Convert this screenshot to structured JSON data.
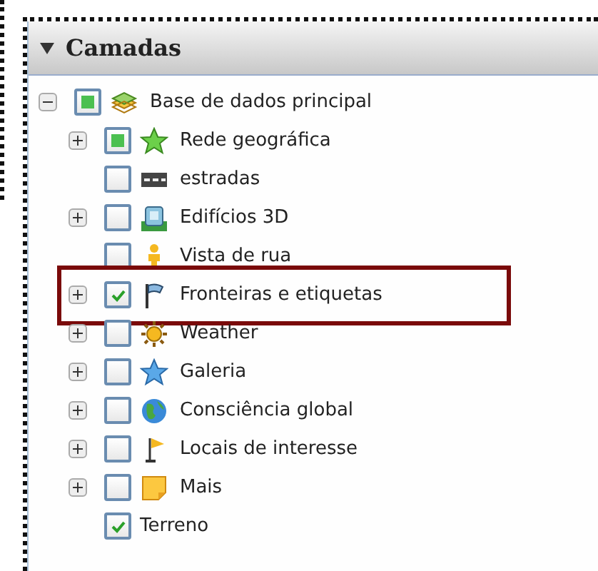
{
  "panel": {
    "title": "Camadas",
    "expanded": true
  },
  "tree": [
    {
      "label": "Base de dados principal",
      "checked": true,
      "partial": true,
      "expanded": true,
      "highlighted": false,
      "children": [
        {
          "label": "Rede geográfica",
          "checked": true,
          "partial": true,
          "expanded": false,
          "highlighted": false
        },
        {
          "label": "estradas",
          "checked": false,
          "partial": false,
          "highlighted": false
        },
        {
          "label": "Edifícios 3D",
          "checked": false,
          "partial": false,
          "expanded": false,
          "highlighted": false
        },
        {
          "label": "Vista de rua",
          "checked": false,
          "partial": false,
          "highlighted": false
        },
        {
          "label": "Fronteiras e etiquetas",
          "checked": true,
          "partial": false,
          "expanded": false,
          "highlighted": true
        },
        {
          "label": "Weather",
          "checked": false,
          "partial": false,
          "expanded": false,
          "highlighted": false
        },
        {
          "label": "Galeria",
          "checked": false,
          "partial": false,
          "expanded": false,
          "highlighted": false
        },
        {
          "label": "Consciência global",
          "checked": false,
          "partial": false,
          "expanded": false,
          "highlighted": false
        },
        {
          "label": "Locais de interesse",
          "checked": false,
          "partial": false,
          "expanded": false,
          "highlighted": false
        },
        {
          "label": "Mais",
          "checked": false,
          "partial": false,
          "expanded": false,
          "highlighted": false
        },
        {
          "label": "Terreno",
          "checked": true,
          "partial": false,
          "highlighted": false
        }
      ]
    }
  ]
}
